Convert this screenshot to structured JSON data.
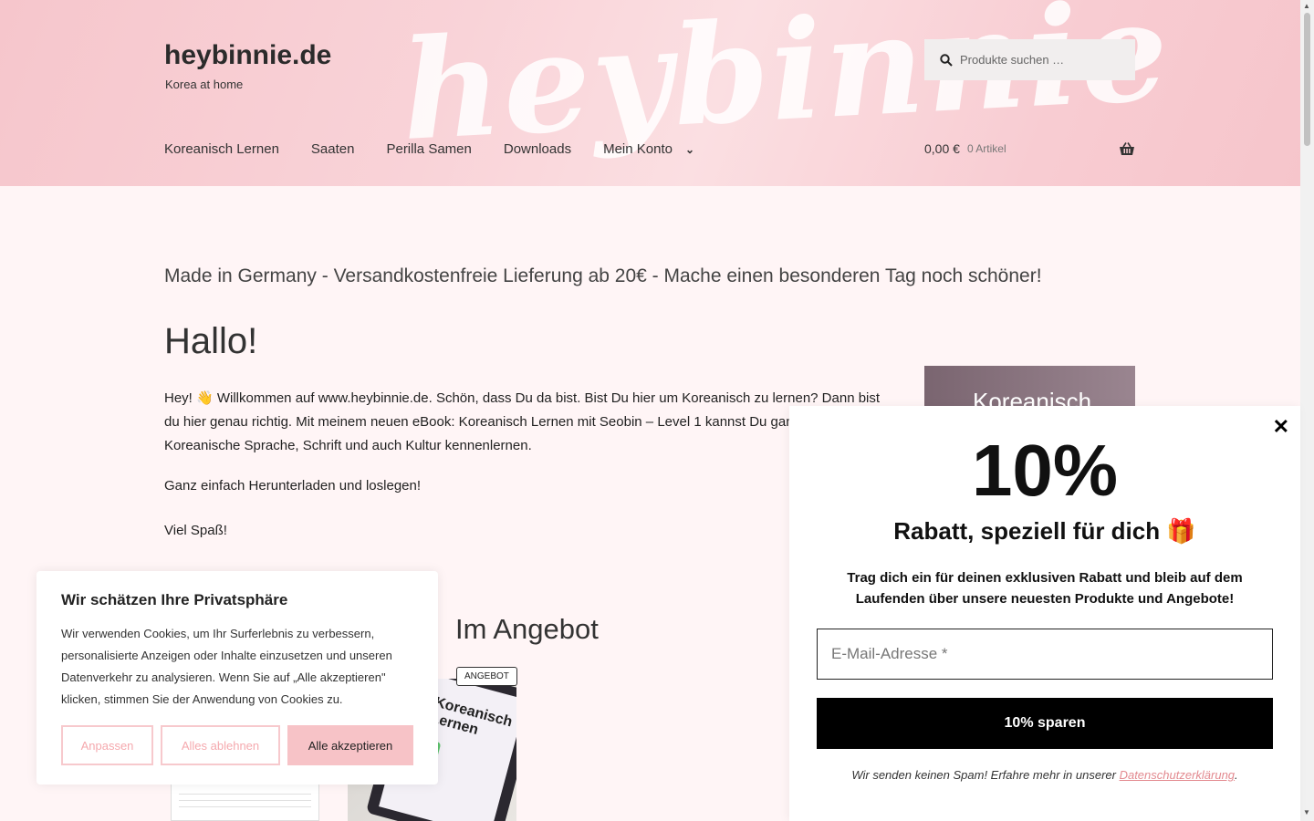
{
  "header": {
    "watermark": "heybinnie",
    "site_title": "heybinnie.de",
    "tagline": "Korea at home",
    "search_placeholder": "Produkte suchen …",
    "nav": [
      {
        "label": "Koreanisch Lernen"
      },
      {
        "label": "Saaten"
      },
      {
        "label": "Perilla Samen"
      },
      {
        "label": "Downloads"
      },
      {
        "label": "Mein Konto"
      }
    ],
    "cart_amount": "0,00 €",
    "cart_count": "0 Artikel"
  },
  "main": {
    "notice": "Made in Germany - Versandkostenfreie Lieferung ab 20€ - Mache einen besonderen Tag noch schöner!",
    "title": "Hallo!",
    "intro": "Hey! 👋 Willkommen auf www.heybinnie.de. Schön, dass Du da bist. Bist Du hier um Koreanisch zu lernen? Dann bist du hier genau richtig. Mit meinem neuen eBook: Koreanisch Lernen mit Seobin – Level 1 kannst Du ganz einfach die Koreanische Sprache, Schrift und auch Kultur kennenlernen.",
    "paragraph2": "Ganz einfach Herunterladen und loslegen!",
    "paragraph3": "Viel Spaß!",
    "section_title": "Im Angebot",
    "sale_badge": "ANGEBOT",
    "product_title": "Koreanisch Lernen",
    "side_banner": "Koreanisch"
  },
  "cookie": {
    "title": "Wir schätzen Ihre Privatsphäre",
    "text": "Wir verwenden Cookies, um Ihr Surferlebnis zu verbessern, personalisierte Anzeigen oder Inhalte einzusetzen und unseren Datenverkehr zu analysieren. Wenn Sie auf „Alle akzeptieren\" klicken, stimmen Sie der Anwendung von Cookies zu.",
    "customize": "Anpassen",
    "reject": "Alles ablehnen",
    "accept": "Alle akzeptieren"
  },
  "popup": {
    "big": "10%",
    "sub": "Rabatt, speziell für dich 🎁",
    "desc": "Trag dich ein für deinen exklusiven Rabatt und bleib auf dem Laufenden über unsere neuesten Produkte und Angebote!",
    "email_placeholder": "E-Mail-Adresse *",
    "cta": "10% sparen",
    "foot_text": "Wir senden keinen Spam! Erfahre mehr in unserer ",
    "foot_link": "Datenschutzerklärung",
    "foot_end": "."
  }
}
